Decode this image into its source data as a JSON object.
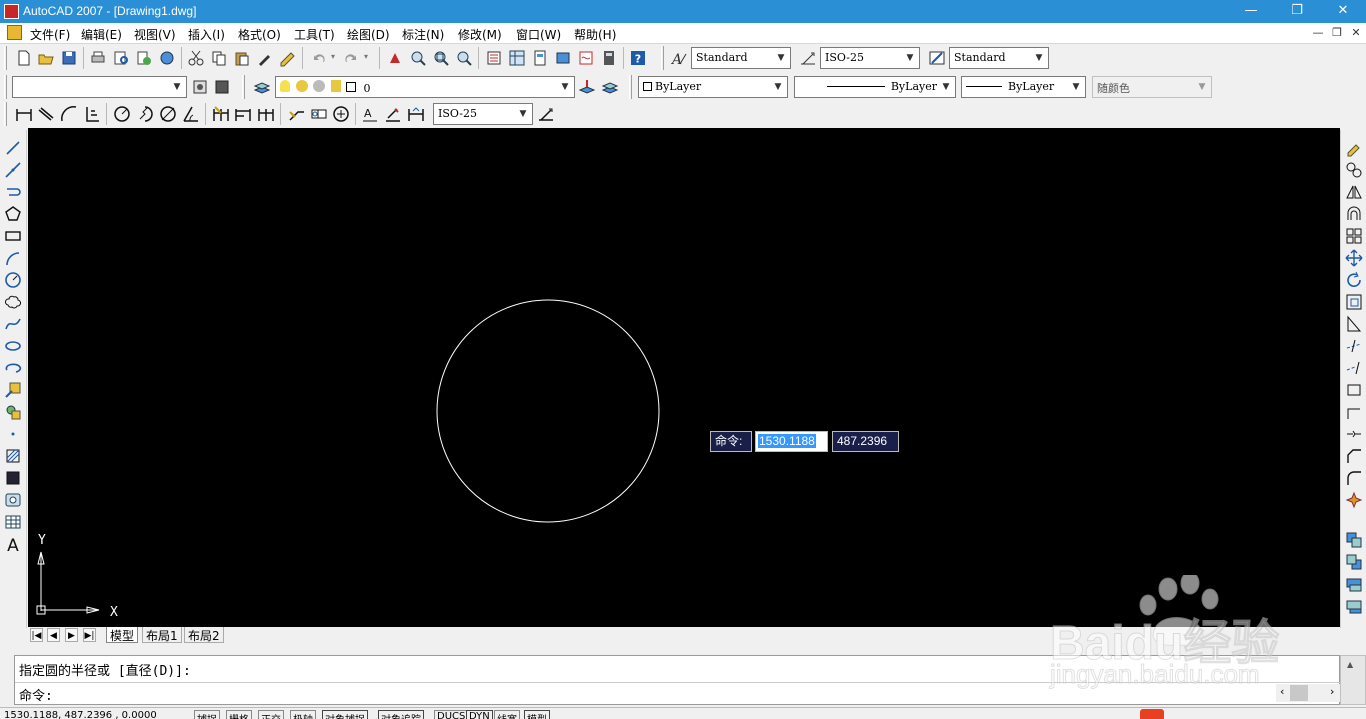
{
  "window": {
    "title": "AutoCAD 2007 - [Drawing1.dwg]",
    "controls": {
      "minimize": "—",
      "restore": "❐",
      "close": "✕"
    }
  },
  "menu": {
    "items": [
      "文件(F)",
      "编辑(E)",
      "视图(V)",
      "插入(I)",
      "格式(O)",
      "工具(T)",
      "绘图(D)",
      "标注(N)",
      "修改(M)",
      "窗口(W)",
      "帮助(H)"
    ],
    "doc_controls": [
      "—",
      "❐",
      "✕"
    ]
  },
  "styles_toolbar": {
    "text_style": "Standard",
    "dim_style": "ISO-25",
    "table_style": "Standard"
  },
  "layers_toolbar": {
    "workspace": "",
    "layer": "0",
    "color": "ByLayer",
    "linetype": "ByLayer",
    "lineweight": "ByLayer",
    "plotstyle": "随颜色"
  },
  "dim_toolbar": {
    "dim_style": "ISO-25"
  },
  "canvas": {
    "background": "#000000",
    "ucs": {
      "x_label": "X",
      "y_label": "Y"
    }
  },
  "dynamic_input": {
    "label": "命令:",
    "x_value": "1530.1188",
    "y_value": "487.2396"
  },
  "layout_tabs": [
    "模型",
    "布局1",
    "布局2"
  ],
  "command_line": {
    "history": "指定圆的半径或 [直径(D)]:",
    "prompt": "命令:"
  },
  "status_bar": {
    "coords": "1530.1188, 487.2396 , 0.0000",
    "toggles": [
      "捕捉",
      "栅格",
      "正交",
      "极轴",
      "对象捕捉",
      "对象追踪",
      "DUCS",
      "DYN",
      "线宽",
      "模型"
    ]
  },
  "watermark": {
    "brand": "Baidu经验",
    "url": "jingyan.baidu.com"
  }
}
